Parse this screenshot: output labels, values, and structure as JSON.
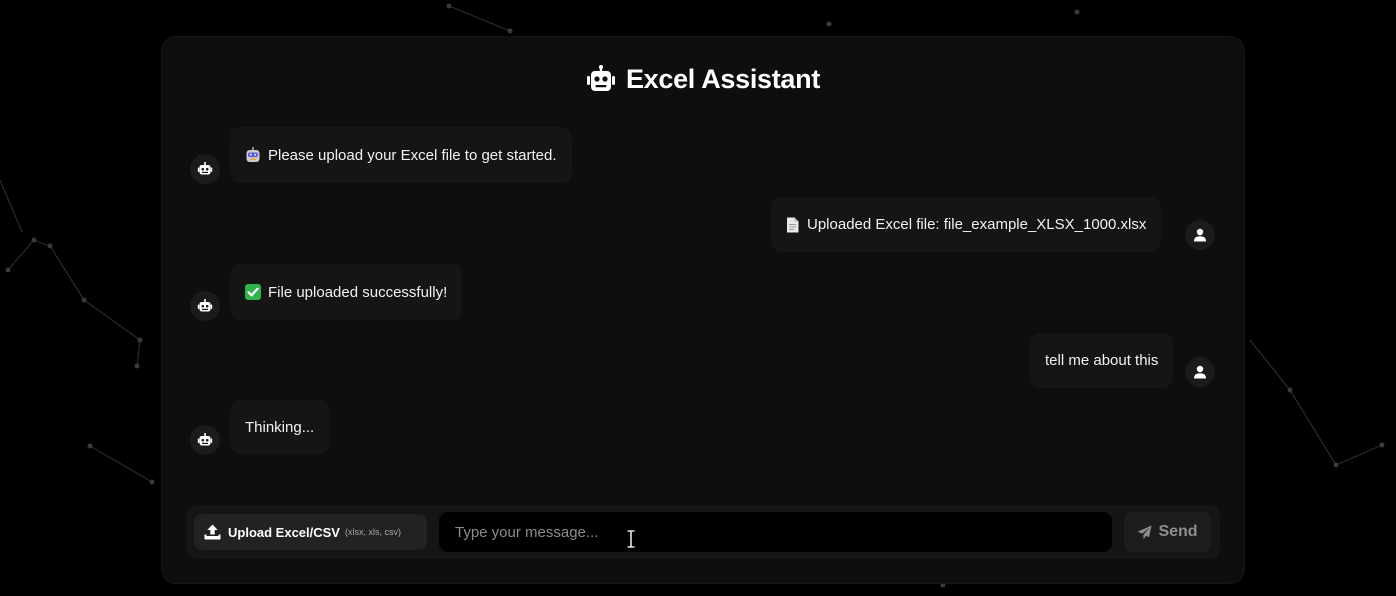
{
  "app": {
    "title": "Excel Assistant",
    "title_icon": "robot-icon"
  },
  "messages": [
    {
      "role": "bot",
      "emoji": "robot-face-emoji",
      "text": "Please upload your Excel file to get started."
    },
    {
      "role": "user",
      "emoji": "document-icon",
      "text": "Uploaded Excel file: file_example_XLSX_1000.xlsx"
    },
    {
      "role": "bot",
      "emoji": "check-mark-emoji",
      "text": "File uploaded successfully!"
    },
    {
      "role": "user",
      "emoji": "",
      "text": "tell me about this"
    },
    {
      "role": "bot",
      "emoji": "",
      "text": "Thinking..."
    }
  ],
  "composer": {
    "upload_label": "Upload Excel/CSV",
    "upload_hint": "(xlsx, xls, csv)",
    "input_placeholder": "Type your message...",
    "input_value": "",
    "send_label": "Send"
  },
  "colors": {
    "background": "#000000",
    "panel": "#0e0e0e",
    "bubble": "#151515",
    "check_green": "#2fb34f"
  }
}
